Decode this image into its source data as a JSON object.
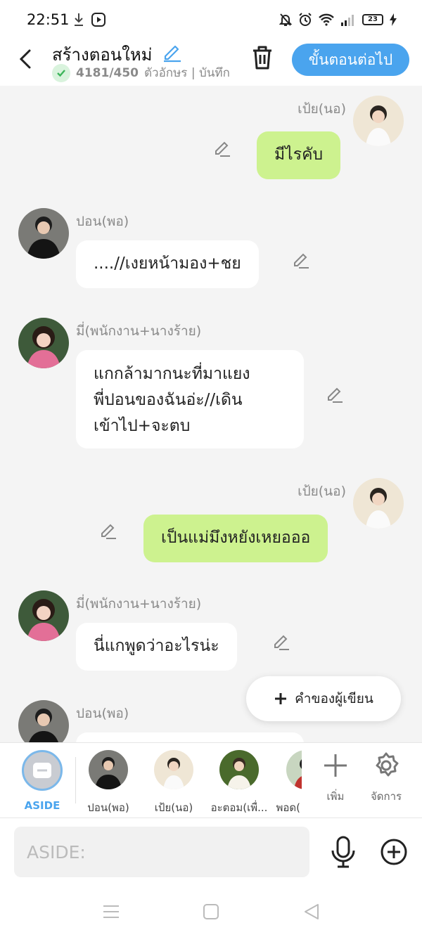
{
  "status_bar": {
    "time": "22:51",
    "battery": "23"
  },
  "header": {
    "title": "สร้างตอนใหม่",
    "char_count": "4181/450",
    "char_rest": " ตัวอักษร | บันทึก",
    "next_label": "ขั้นตอนต่อไป"
  },
  "messages": [
    {
      "side": "right",
      "name": "เป้ย(นอ)",
      "text": "มีไรคับ"
    },
    {
      "side": "left",
      "name": "ปอน(พอ)",
      "text": "....//เงยหน้ามอง+ชย"
    },
    {
      "side": "left",
      "name": "มี่(พนักงาน+นางร้าย)",
      "lines": [
        "แกกล้ามากนะที่มาแยง",
        "พี่ปอนของฉันอ่ะ//เดิน",
        "เข้าไป+จะตบ"
      ]
    },
    {
      "side": "right",
      "name": "เป้ย(นอ)",
      "text": "เป็นแม่มึงหยังเหยอออ"
    },
    {
      "side": "left",
      "name": "มี่(พนักงาน+นางร้าย)",
      "text": "นี่แกพูดว่าอะไรน่ะ"
    },
    {
      "side": "left",
      "name": "ปอน(พอ)",
      "text": ""
    }
  ],
  "narrator_button": {
    "label": "คำของผู้เขียน"
  },
  "characters": [
    {
      "label": "ASIDE"
    },
    {
      "label": "ปอน(พอ)"
    },
    {
      "label": "เป้ย(นอ)"
    },
    {
      "label": "อะตอม(เพื่..."
    },
    {
      "label": "พอด("
    }
  ],
  "tools": {
    "add_label": "เพิ่ม",
    "manage_label": "จัดการ"
  },
  "input": {
    "placeholder": "ASIDE:"
  },
  "colors": {
    "accent": "#4aa4ee",
    "right_bubble": "#cdf28f",
    "check": "#3cb55a"
  }
}
